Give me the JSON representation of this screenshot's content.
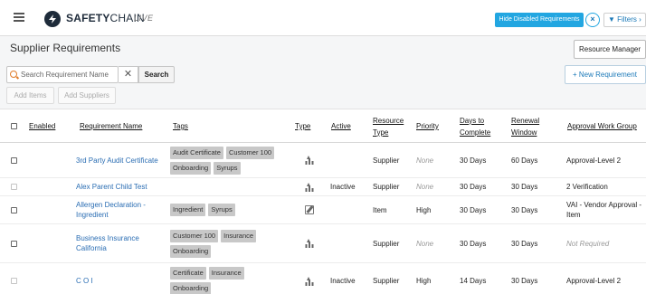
{
  "app": {
    "brand_bold": "SAFETY",
    "brand_light": "CHAIN",
    "environment": "LIVE"
  },
  "topbar": {
    "hide_disabled_label": "Hide Disabled Requirements",
    "clear_filter_glyph": "×",
    "filters_label": "▼ Filters ›"
  },
  "page": {
    "title": "Supplier Requirements",
    "resource_manager_label": "Resource Manager"
  },
  "search": {
    "placeholder": "Search Requirement Name",
    "value": "",
    "clear_glyph": "✕",
    "button_label": "Search"
  },
  "actions": {
    "new_requirement_label": "+ New Requirement",
    "add_items_label": "Add Items",
    "add_suppliers_label": "Add Suppliers"
  },
  "table": {
    "headers": {
      "enabled": "Enabled",
      "requirement_name": "Requirement Name",
      "tags": "Tags",
      "type": "Type",
      "active": "Active",
      "resource_type": "Resource Type",
      "priority": "Priority",
      "days_to_complete": "Days to Complete",
      "renewal_window": "Renewal Window",
      "approval_work_group": "Approval Work Group"
    },
    "rows": [
      {
        "name": "3rd Party Audit Certificate",
        "tags": [
          "Audit Certificate",
          "Customer 100",
          "Onboarding",
          "Syrups"
        ],
        "type_icon": "upload-icon",
        "active": "",
        "resource_type": "Supplier",
        "priority": "None",
        "days_to_complete": "30 Days",
        "renewal_window": "60 Days",
        "approval_work_group": "Approval-Level 2"
      },
      {
        "name": "Alex Parent Child Test",
        "tags": [],
        "type_icon": "upload-icon",
        "active": "Inactive",
        "resource_type": "Supplier",
        "priority": "None",
        "days_to_complete": "30 Days",
        "renewal_window": "30 Days",
        "approval_work_group": "2 Verification"
      },
      {
        "name": "Allergen Declaration - Ingredient",
        "tags": [
          "Ingredient",
          "Syrups"
        ],
        "type_icon": "edit-icon",
        "active": "",
        "resource_type": "Item",
        "priority": "High",
        "days_to_complete": "30 Days",
        "renewal_window": "30 Days",
        "approval_work_group": "VAI - Vendor Approval - Item"
      },
      {
        "name": "Business Insurance California",
        "tags": [
          "Customer 100",
          "Insurance",
          "Onboarding"
        ],
        "type_icon": "upload-icon",
        "active": "",
        "resource_type": "Supplier",
        "priority": "None",
        "days_to_complete": "30 Days",
        "renewal_window": "30 Days",
        "approval_work_group": "Not Required"
      },
      {
        "name": "C O I",
        "tags": [
          "Certificate",
          "Insurance",
          "Onboarding"
        ],
        "type_icon": "upload-icon",
        "active": "Inactive",
        "resource_type": "Supplier",
        "priority": "High",
        "days_to_complete": "14 Days",
        "renewal_window": "30 Days",
        "approval_work_group": "Approval-Level 2"
      }
    ]
  },
  "colors": {
    "accent": "#22a6e1",
    "link": "#2a6db3",
    "tag_bg": "#c8c8c8",
    "search_icon": "#e07c2a"
  }
}
